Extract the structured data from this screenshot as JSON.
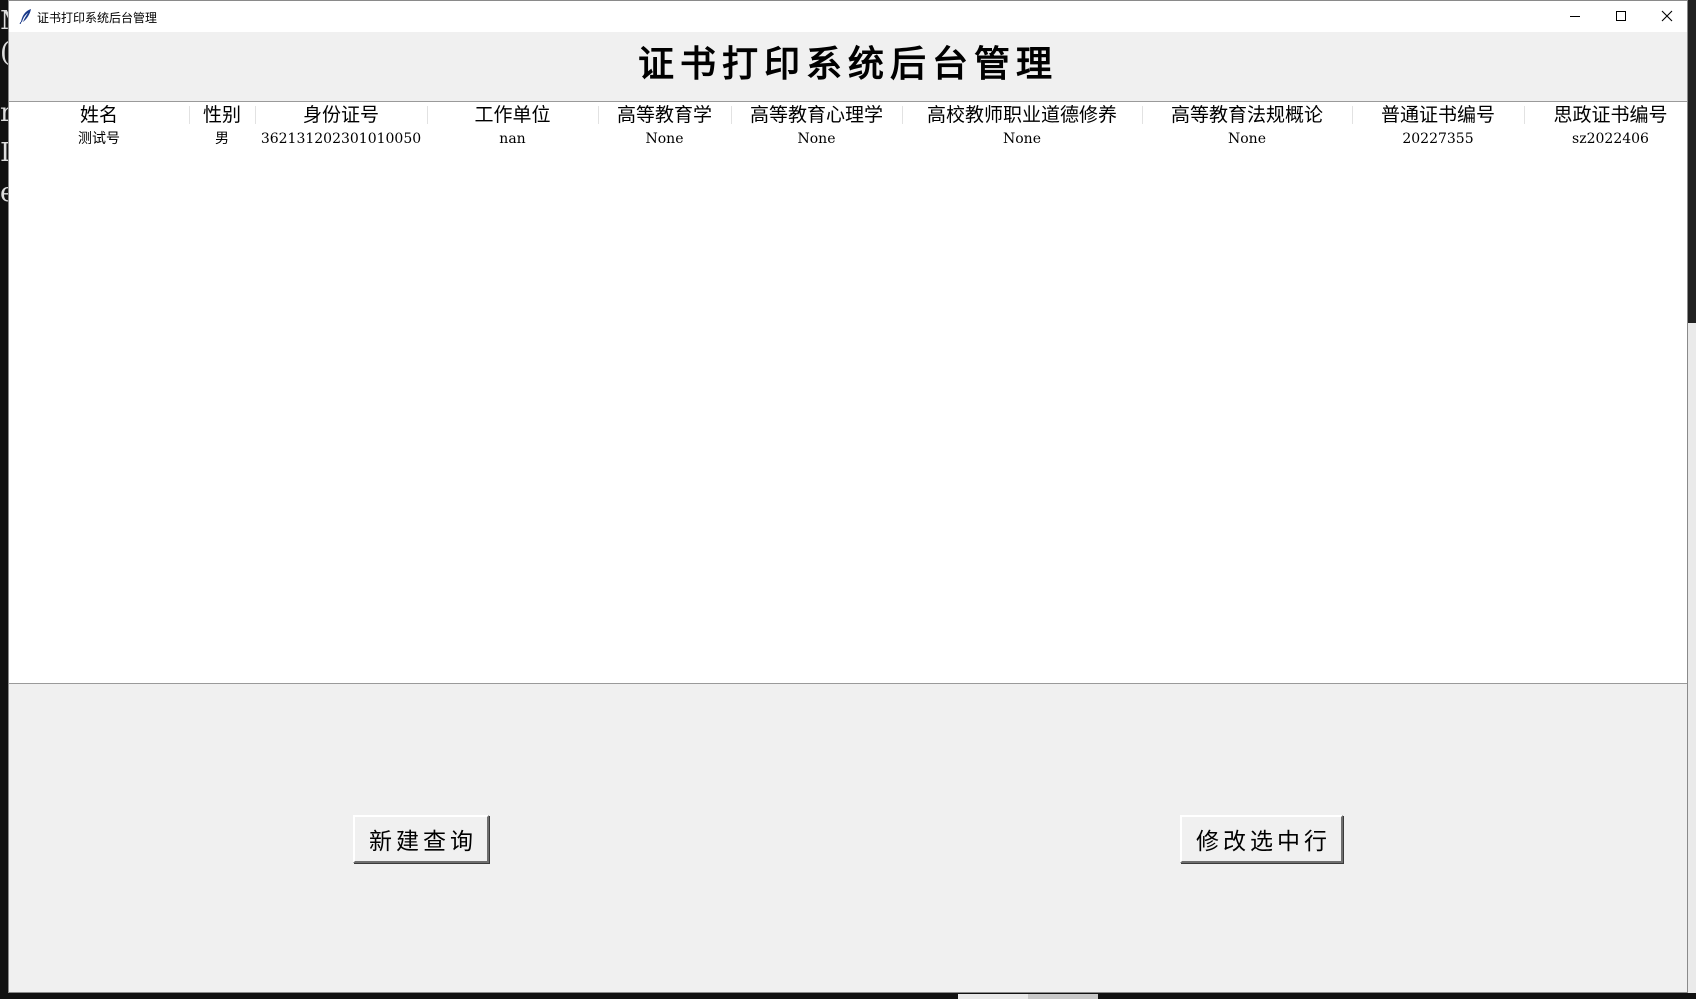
{
  "window": {
    "title": "证书打印系统后台管理"
  },
  "header": {
    "title": "证书打印系统后台管理"
  },
  "table": {
    "columns": [
      "姓名",
      "性别",
      "身份证号",
      "工作单位",
      "高等教育学",
      "高等教育心理学",
      "高校教师职业道德修养",
      "高等教育法规概论",
      "普通证书编号",
      "思政证书编号"
    ],
    "rows": [
      [
        "测试号",
        "男",
        "362131202301010050",
        "nan",
        "None",
        "None",
        "None",
        "None",
        "20227355",
        "sz2022406"
      ]
    ]
  },
  "actions": {
    "new_query_label": "新建查询",
    "edit_row_label": "修改选中行"
  },
  "icons": {
    "app": "feather-icon",
    "minimize": "minimize-icon",
    "maximize": "maximize-icon",
    "close": "close-icon"
  }
}
